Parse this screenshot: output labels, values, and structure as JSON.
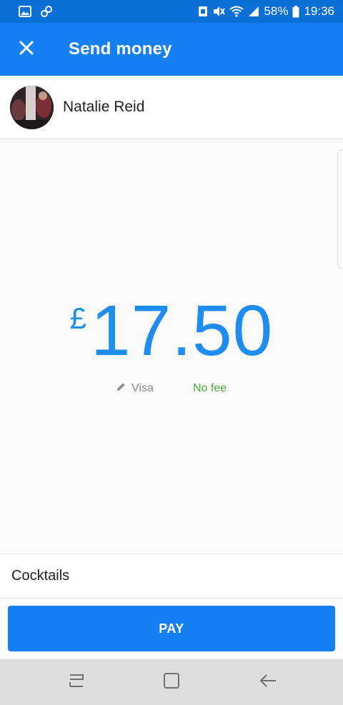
{
  "status_bar": {
    "left_icons": [
      "image-icon",
      "link-icon"
    ],
    "right_icons": [
      "nfc-icon",
      "mute-icon",
      "wifi-icon",
      "signal-icon"
    ],
    "battery": "58%",
    "time": "19:36"
  },
  "app_bar": {
    "title": "Send money",
    "close_icon": "close-icon"
  },
  "recipient": {
    "name": "Natalie Reid"
  },
  "amount": {
    "currency": "£",
    "value": "17.50"
  },
  "payment": {
    "method": "Visa",
    "fee": "No fee"
  },
  "note": {
    "text": "Cocktails"
  },
  "pay_button": {
    "label": "PAY"
  },
  "colors": {
    "status_bar": "#0b6fd8",
    "primary": "#1680f2",
    "amount": "#1f8cf0",
    "fee": "#47b23a"
  }
}
